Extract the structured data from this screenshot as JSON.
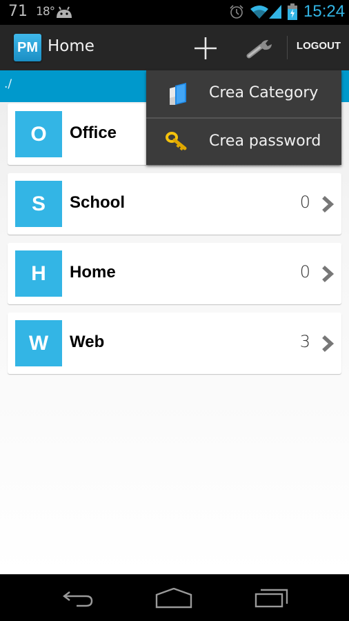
{
  "status_bar": {
    "battery_percent": "71",
    "temperature": "18°",
    "time": "15:24",
    "icons": [
      "android-icon",
      "alarm-icon",
      "wifi-icon",
      "signal-icon",
      "battery-charging-icon"
    ]
  },
  "action_bar": {
    "logo_text": "PM",
    "title": "Home",
    "add_icon": "plus-icon",
    "settings_icon": "wrench-icon",
    "logout_label": "LOGOUT"
  },
  "path": {
    "text": "./"
  },
  "categories": [
    {
      "initial": "O",
      "name": "Office",
      "count": ""
    },
    {
      "initial": "S",
      "name": "School",
      "count": "0"
    },
    {
      "initial": "H",
      "name": "Home",
      "count": "0"
    },
    {
      "initial": "W",
      "name": "Web",
      "count": "3"
    }
  ],
  "popup_menu": {
    "items": [
      {
        "label": "Crea Category",
        "icon": "folder-icon"
      },
      {
        "label": "Crea password",
        "icon": "key-icon"
      }
    ]
  },
  "nav_bar": {
    "buttons": [
      "back-icon",
      "home-icon",
      "recent-apps-icon"
    ]
  },
  "colors": {
    "accent": "#33b5e5",
    "path_bar": "#0099cc",
    "action_bar": "#262626",
    "popup": "#3b3b3b"
  }
}
